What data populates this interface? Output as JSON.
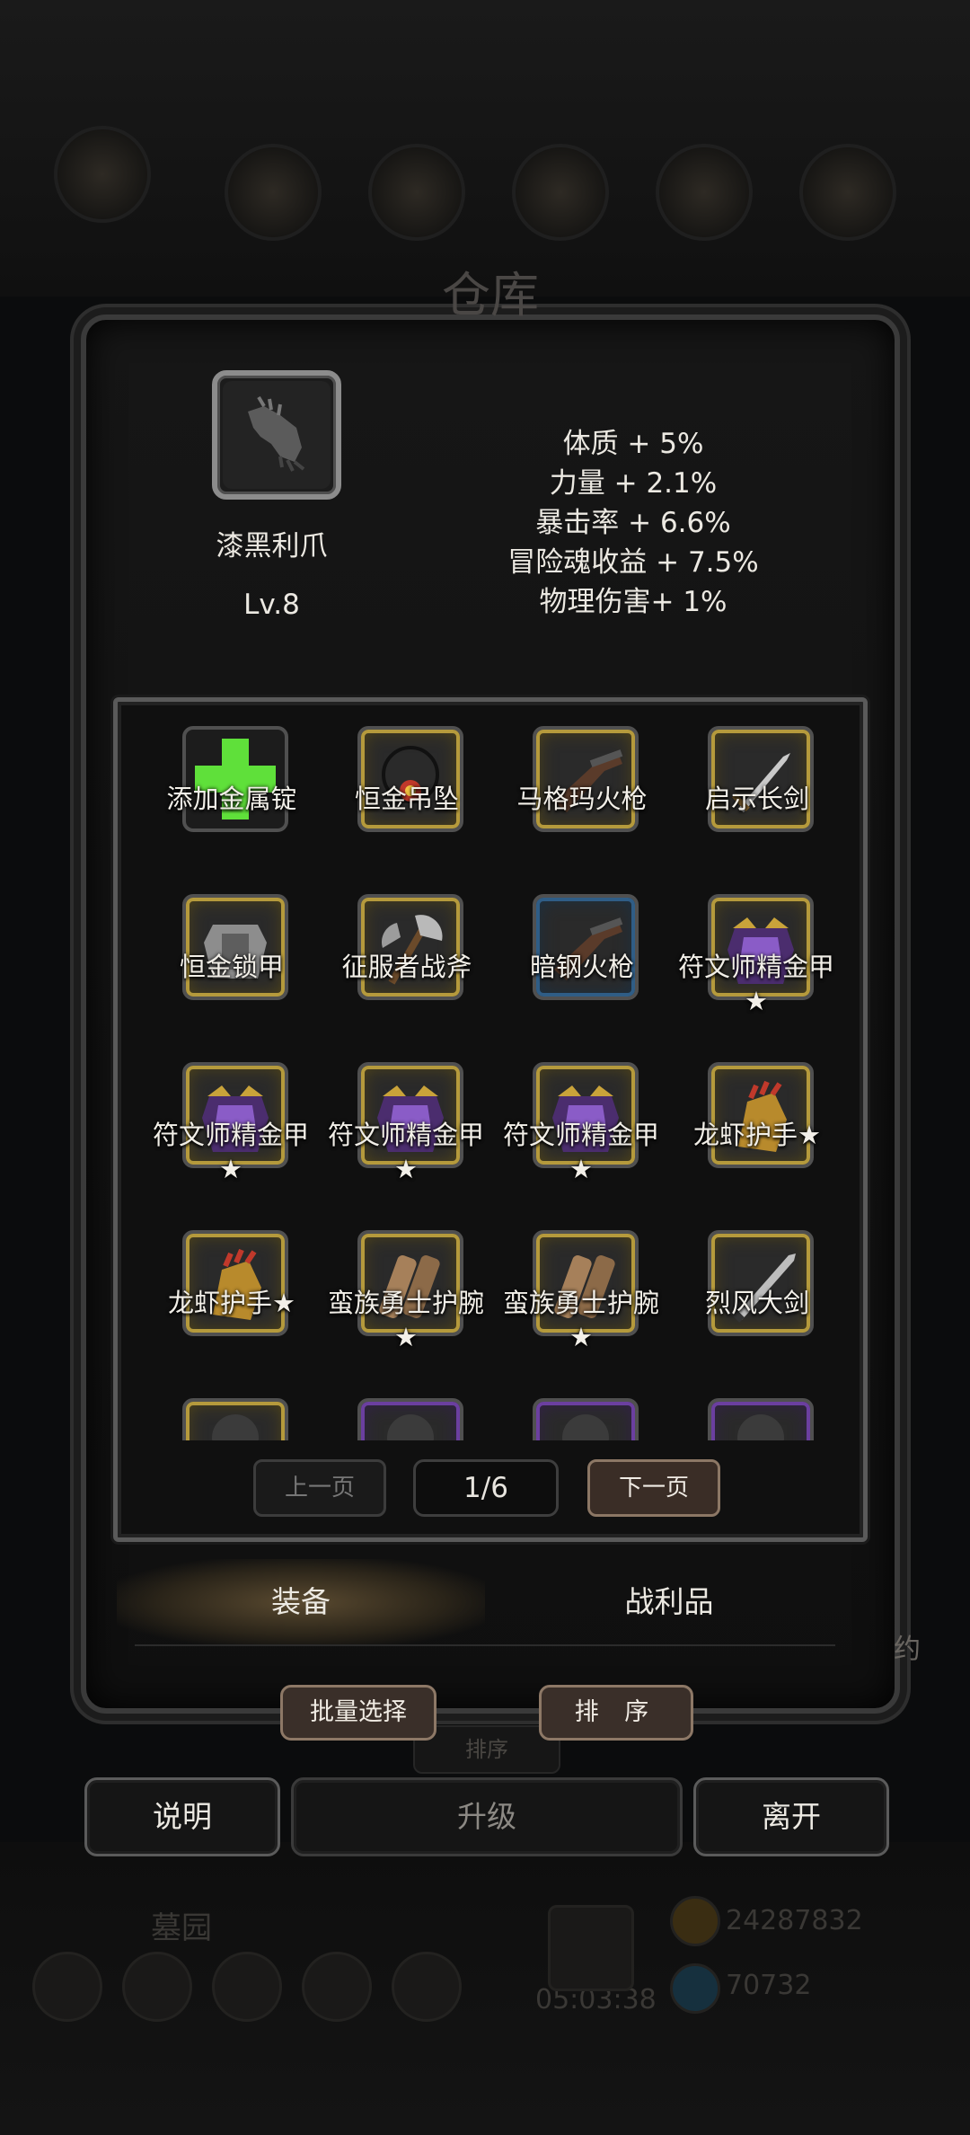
{
  "window": {
    "title": "仓库"
  },
  "detail": {
    "name": "漆黑利爪",
    "level": "Lv.8",
    "stats": [
      "体质 + 5%",
      "力量 + 2.1%",
      "暴击率 + 6.6%",
      "冒险魂收益 + 7.5%",
      "物理伤害+ 1%"
    ]
  },
  "grid": {
    "items": [
      {
        "label": "添加金属锭",
        "icon": "green-plus-icon",
        "frame": "none"
      },
      {
        "label": "恒金吊坠",
        "icon": "pendant-icon",
        "frame": "gold"
      },
      {
        "label": "马格玛火枪",
        "icon": "musket-icon",
        "frame": "gold"
      },
      {
        "label": "启示长剑",
        "icon": "longsword-icon",
        "frame": "gold"
      },
      {
        "label": "恒金锁甲",
        "icon": "chainmail-icon",
        "frame": "gold"
      },
      {
        "label": "征服者战斧",
        "icon": "battle-axe-icon",
        "frame": "gold"
      },
      {
        "label": "暗钢火枪",
        "icon": "musket-icon",
        "frame": "blue"
      },
      {
        "label": "符文师精金甲★",
        "icon": "purple-armor-icon",
        "frame": "gold"
      },
      {
        "label": "符文师精金甲★",
        "icon": "purple-armor-icon",
        "frame": "gold"
      },
      {
        "label": "符文师精金甲★",
        "icon": "purple-armor-icon",
        "frame": "gold"
      },
      {
        "label": "符文师精金甲★",
        "icon": "purple-armor-icon",
        "frame": "gold"
      },
      {
        "label": "龙虾护手★",
        "icon": "gauntlet-icon",
        "frame": "gold"
      },
      {
        "label": "龙虾护手★",
        "icon": "gauntlet-icon",
        "frame": "gold"
      },
      {
        "label": "蛮族勇士护腕★",
        "icon": "bracer-icon",
        "frame": "gold"
      },
      {
        "label": "蛮族勇士护腕★",
        "icon": "bracer-icon",
        "frame": "gold"
      },
      {
        "label": "烈风大剑",
        "icon": "greatsword-icon",
        "frame": "gold"
      },
      {
        "label": "",
        "icon": "partial-item-icon",
        "frame": "gold"
      },
      {
        "label": "",
        "icon": "partial-item-icon",
        "frame": "purple"
      },
      {
        "label": "",
        "icon": "partial-item-icon",
        "frame": "purple"
      },
      {
        "label": "",
        "icon": "partial-item-icon",
        "frame": "purple"
      }
    ]
  },
  "pager": {
    "prev": "上一页",
    "page": "1/6",
    "next": "下一页"
  },
  "tabs": {
    "equipment": "装备",
    "loot": "战利品"
  },
  "buttons": {
    "batch_select": "批量选择",
    "sort": "排 序",
    "explain": "说明",
    "upgrade": "升级",
    "leave": "离开"
  },
  "background": {
    "side_text": "约",
    "ghost_sort": "排序",
    "area_label": "墓园",
    "timer": "05:03:38",
    "gold": "24287832",
    "gems": "70732"
  },
  "colors": {
    "gold_frame": "#b59a3c",
    "blue_frame": "#2f5d86",
    "purple_frame": "#6b3fa0"
  }
}
